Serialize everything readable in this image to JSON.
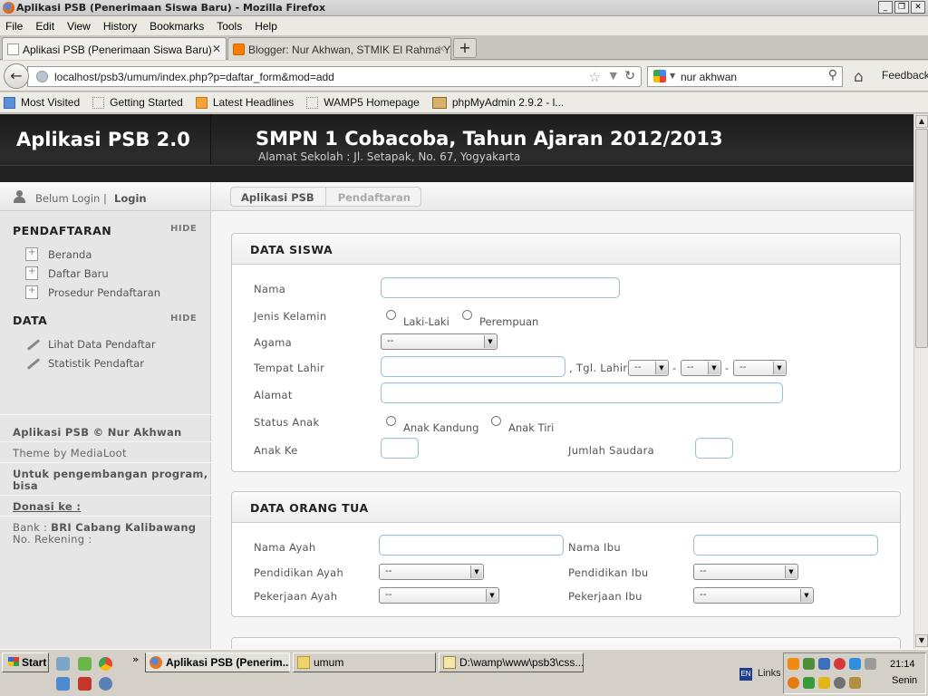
{
  "window": {
    "title": "Aplikasi PSB (Penerimaan Siswa Baru) - Mozilla Firefox"
  },
  "menu": [
    "File",
    "Edit",
    "View",
    "History",
    "Bookmarks",
    "Tools",
    "Help"
  ],
  "tabs": [
    {
      "label": "Aplikasi PSB (Penerimaan Siswa Baru)"
    },
    {
      "label": "Blogger: Nur Akhwan, STMIK El Rahma Y..."
    }
  ],
  "nav": {
    "url": "localhost/psb3/umum/index.php?p=daftar_form&mod=add",
    "search": "nur akhwan",
    "feedback": "Feedback"
  },
  "bookmarks": [
    "Most Visited",
    "Getting Started",
    "Latest Headlines",
    "WAMP5 Homepage",
    "phpMyAdmin 2.9.2 - l..."
  ],
  "header": {
    "app_name": "Aplikasi PSB 2.0",
    "school": "SMPN 1 Cobacoba, Tahun Ajaran 2012/2013",
    "address": "Alamat Sekolah : Jl. Setapak, No. 67, Yogyakarta"
  },
  "user": {
    "status": "Belum Login |",
    "login": "Login"
  },
  "breadcrumb": [
    "Aplikasi PSB",
    "Pendaftaran"
  ],
  "sidebar": {
    "hide_label": "HIDE",
    "pendaftaran": {
      "title": "PENDAFTARAN",
      "items": [
        "Beranda",
        "Daftar Baru",
        "Prosedur Pendaftaran"
      ]
    },
    "data": {
      "title": "DATA",
      "items": [
        "Lihat Data Pendaftar",
        "Statistik Pendaftar"
      ]
    },
    "footer": {
      "copyright": "Aplikasi PSB © Nur Akhwan",
      "theme": "Theme by MediaLoot",
      "dev1": "Untuk pengembangan program,",
      "dev2": "bisa",
      "donasi": "Donasi ke :",
      "bank_label": "Bank : ",
      "bank_value": "BRI Cabang Kalibawang",
      "rekening": "No. Rekening :"
    }
  },
  "form_siswa": {
    "title": "DATA SISWA",
    "nama": "Nama",
    "jenis_kelamin": "Jenis Kelamin",
    "laki": "Laki-Laki",
    "perempuan": "Perempuan",
    "agama": "Agama",
    "agama_value": "--",
    "tempat_lahir": "Tempat Lahir",
    "tgl_lahir": ", Tgl. Lahir",
    "tgl_value": "--",
    "dash": "-",
    "alamat": "Alamat",
    "status_anak": "Status Anak",
    "kandung": "Anak Kandung",
    "tiri": "Anak Tiri",
    "anak_ke": "Anak Ke",
    "jumlah_saudara": "Jumlah Saudara"
  },
  "form_ortu": {
    "title": "DATA ORANG TUA",
    "nama_ayah": "Nama Ayah",
    "nama_ibu": "Nama Ibu",
    "pendidikan_ayah": "Pendidikan Ayah",
    "pendidikan_ibu": "Pendidikan Ibu",
    "pekerjaan_ayah": "Pekerjaan Ayah",
    "pekerjaan_ibu": "Pekerjaan Ibu",
    "select_value": "--"
  },
  "taskbar": {
    "start": "Start",
    "buttons": [
      "Aplikasi PSB (Penerim...",
      "umum",
      "D:\\wamp\\www\\psb3\\css..."
    ],
    "links": "Links",
    "lang": "EN",
    "time": "21:14",
    "day": "Senin"
  }
}
